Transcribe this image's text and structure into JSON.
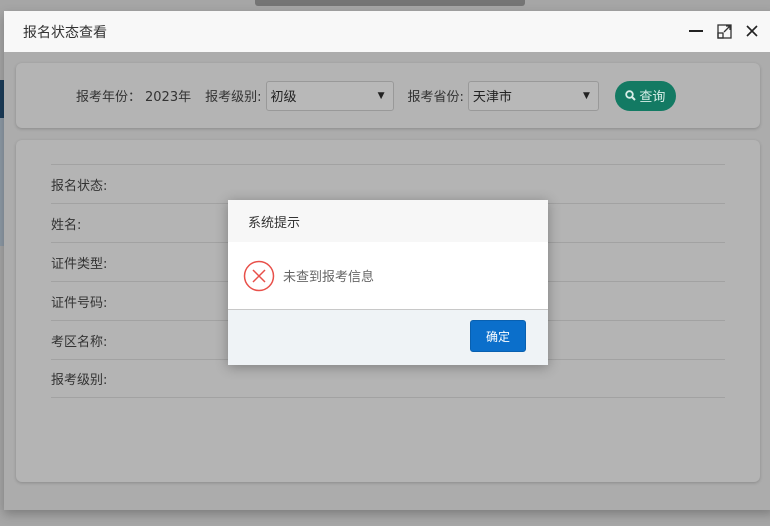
{
  "window": {
    "title": "报名状态查看"
  },
  "search": {
    "year_label": "报考年份：",
    "year_value": "2023年",
    "level_label": "报考级别:",
    "level_value": "初级",
    "province_label": "报考省份:",
    "province_value": "天津市",
    "query_button": "查询"
  },
  "result": {
    "fields": [
      "报名状态:",
      "姓名:",
      "证件类型:",
      "证件号码:",
      "考区名称:",
      "报考级别:"
    ]
  },
  "dialog": {
    "title": "系统提示",
    "message": "未查到报考信息",
    "ok_button": "确定",
    "error_color": "#e8504a"
  }
}
